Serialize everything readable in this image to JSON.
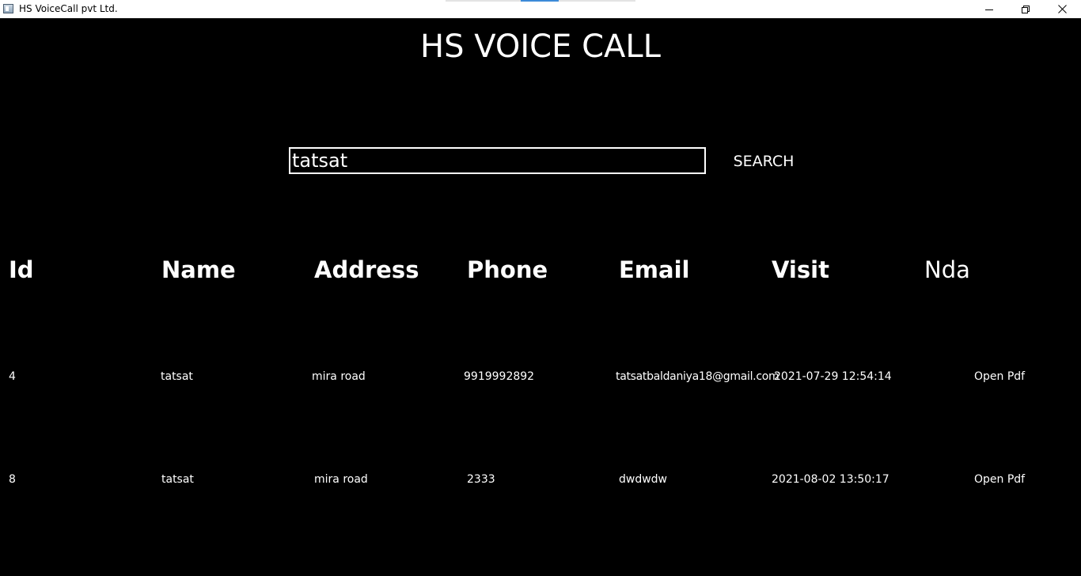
{
  "window": {
    "title": "HS VoiceCall pvt Ltd.",
    "controls": [
      "minimize-icon",
      "restore-icon",
      "close-icon"
    ]
  },
  "header": {
    "title": "HS VOICE CALL"
  },
  "search": {
    "value": "tatsat",
    "button_label": "SEARCH"
  },
  "table": {
    "columns": [
      "Id",
      "Name",
      "Address",
      "Phone",
      "Email",
      "Visit",
      "Nda"
    ],
    "rows": [
      {
        "id": "4",
        "name": "tatsat",
        "address": "mira road",
        "phone": "9919992892",
        "email": "tatsatbaldaniya18@gmail.com",
        "visit": "2021-07-29 12:54:14",
        "nda": "Open Pdf"
      },
      {
        "id": "8",
        "name": "tatsat",
        "address": "mira road",
        "phone": "2333",
        "email": "dwdwdw",
        "visit": "2021-08-02 13:50:17",
        "nda": "Open Pdf"
      }
    ]
  },
  "colors": {
    "background": "#000000",
    "text": "#ffffff",
    "titlebar": "#ffffff"
  }
}
